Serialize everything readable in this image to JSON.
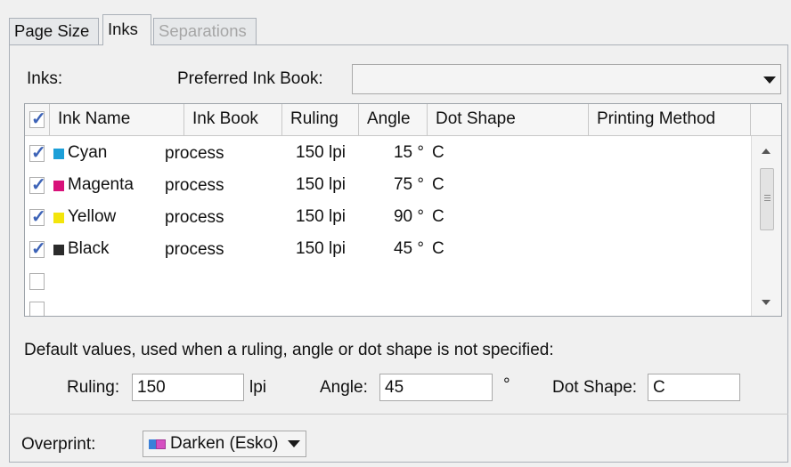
{
  "tabs": [
    {
      "label": "Page Size"
    },
    {
      "label": "Inks"
    },
    {
      "label": "Separations"
    }
  ],
  "inks_label": "Inks:",
  "preferred_ink_book": {
    "label": "Preferred Ink Book:",
    "value": ""
  },
  "table": {
    "columns": [
      "Ink Name",
      "Ink Book",
      "Ruling",
      "Angle",
      "Dot Shape",
      "Printing Method"
    ],
    "rows": [
      {
        "checked": true,
        "name": "Cyan",
        "color": "#1c9fd8",
        "book": "process",
        "ruling": "150 lpi",
        "angle": "15 °",
        "dot": "C",
        "method": ""
      },
      {
        "checked": true,
        "name": "Magenta",
        "color": "#d8127a",
        "book": "process",
        "ruling": "150 lpi",
        "angle": "75 °",
        "dot": "C",
        "method": ""
      },
      {
        "checked": true,
        "name": "Yellow",
        "color": "#f3e50c",
        "book": "process",
        "ruling": "150 lpi",
        "angle": "90 °",
        "dot": "C",
        "method": ""
      },
      {
        "checked": true,
        "name": "Black",
        "color": "#2b2b2b",
        "book": "process",
        "ruling": "150 lpi",
        "angle": "45 °",
        "dot": "C",
        "method": ""
      }
    ]
  },
  "defaults": {
    "description": "Default values, used when a ruling, angle or dot shape is not specified:",
    "ruling_label": "Ruling:",
    "ruling_value": "150",
    "ruling_unit": "lpi",
    "angle_label": "Angle:",
    "angle_value": "45",
    "angle_unit": "°",
    "dot_shape_label": "Dot Shape:",
    "dot_shape_value": "C"
  },
  "overprint": {
    "label": "Overprint:",
    "value": "Darken (Esko)",
    "icon": "overprint-darken-icon"
  }
}
